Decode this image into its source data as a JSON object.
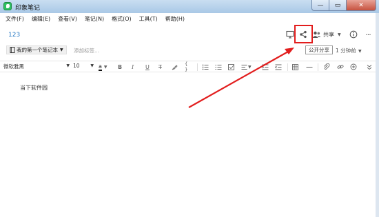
{
  "window": {
    "title": "印象笔记",
    "min_icon": "minimize-icon",
    "max_icon": "maximize-icon",
    "close_icon": "close-icon"
  },
  "menu": [
    "文件(F)",
    "编辑(E)",
    "查看(V)",
    "笔记(N)",
    "格式(O)",
    "工具(T)",
    "帮助(H)"
  ],
  "note": {
    "title": "123",
    "notebook": "我的第一个笔记本",
    "tag_placeholder": "添加标签...",
    "body": "当下软件园"
  },
  "header": {
    "share_label": "共享",
    "public_share": "公开分享",
    "modified": "1 分钟前"
  },
  "toolbar": {
    "font": "微软雅黑",
    "size": "10"
  },
  "colors": {
    "accent": "#2b7bc6",
    "highlight": "#e21d1d",
    "app": "#2dbe60"
  }
}
